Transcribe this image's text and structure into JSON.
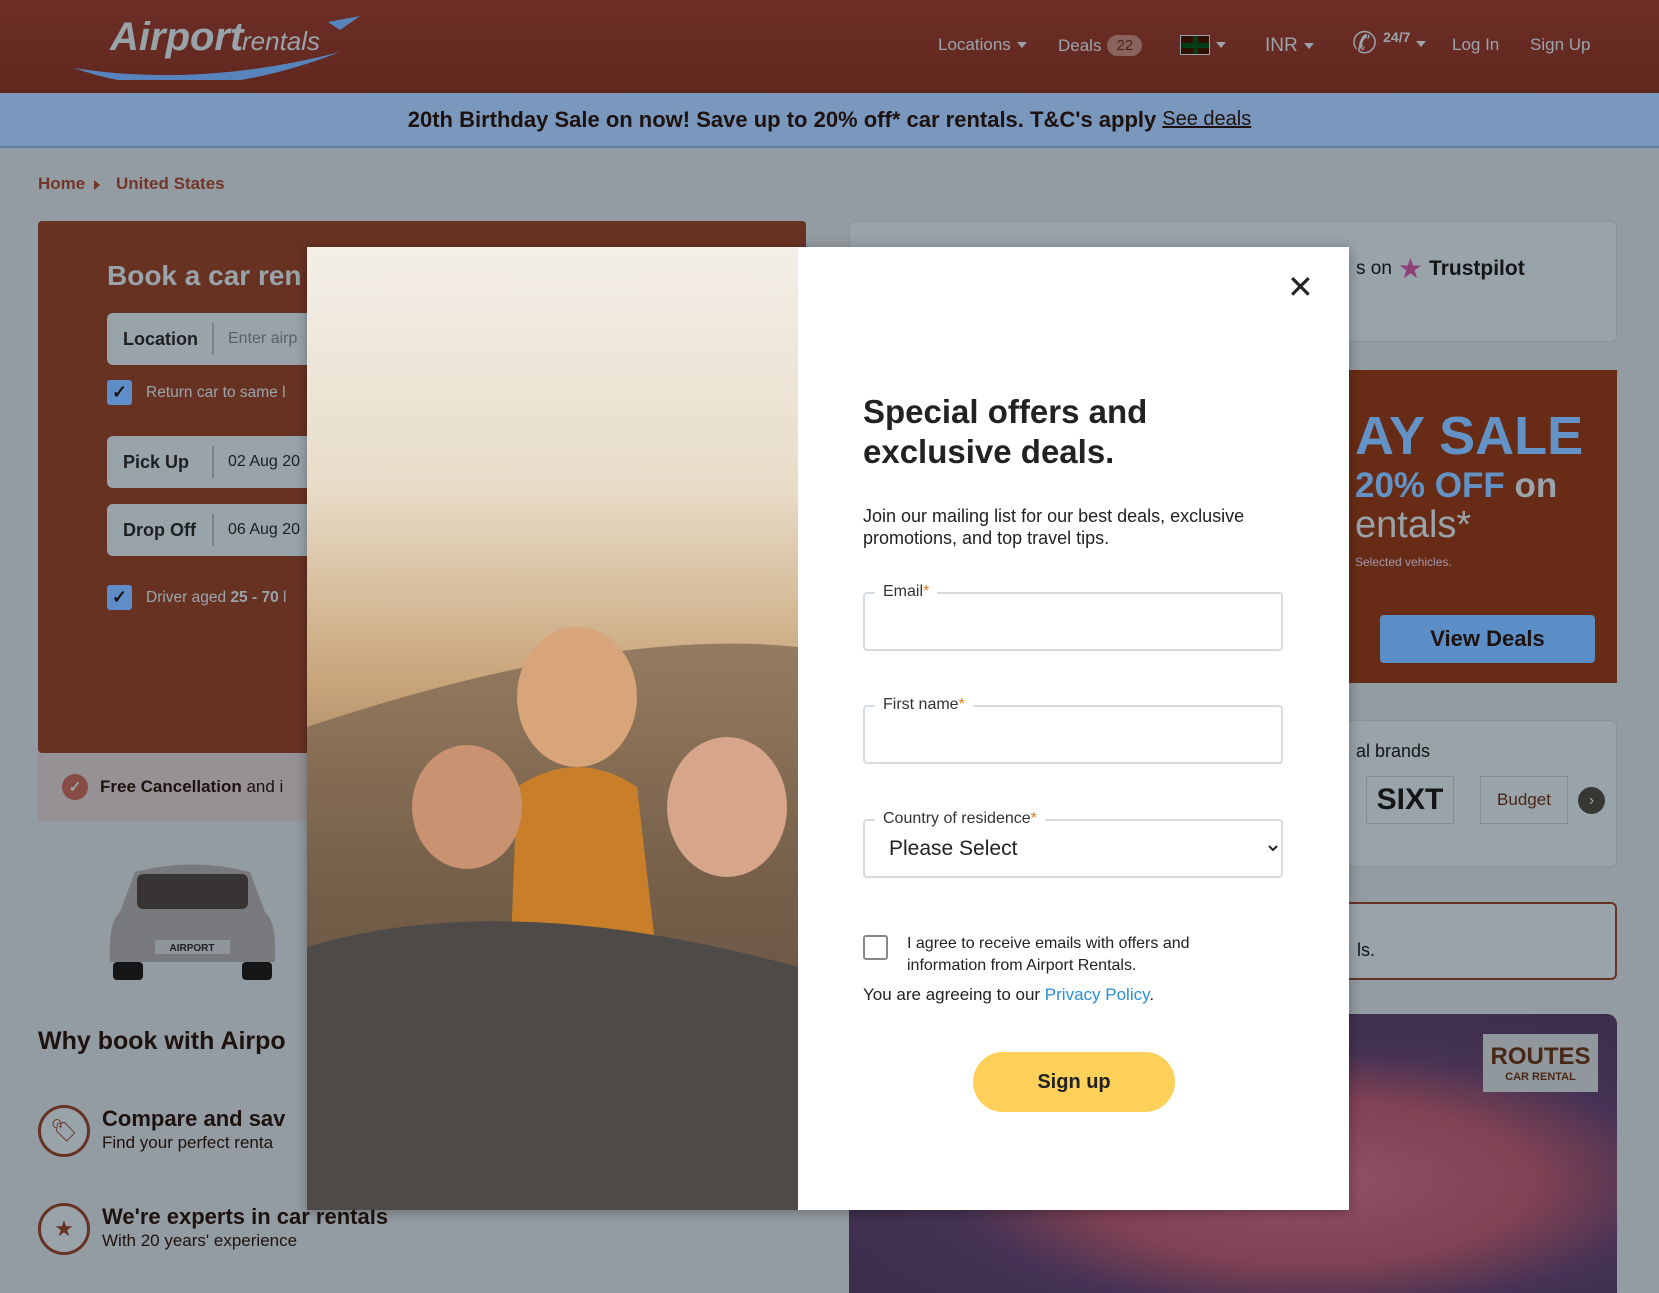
{
  "header": {
    "logo": "Airport rentals",
    "nav": {
      "locations": "Locations",
      "deals": "Deals",
      "deals_count": "22",
      "language_icon": "uk-flag-icon",
      "currency": "INR",
      "phone": "24/7",
      "login": "Log In",
      "signup": "Sign Up"
    }
  },
  "banner": {
    "text": "20th Birthday Sale on now! Save up to 20% off* car rentals. T&C's apply",
    "link": "See deals"
  },
  "breadcrumb": [
    "Home",
    "United States"
  ],
  "booking": {
    "title": "Book a car ren",
    "location_label": "Location",
    "location_placeholder": "Enter airp",
    "return_same": "Return car to same l",
    "pickup_label": "Pick Up",
    "pickup_value": "02 Aug 20",
    "dropoff_label": "Drop Off",
    "dropoff_value": "06 Aug 20",
    "driver_prefix": "Driver aged ",
    "driver_age": "25 - 70",
    "driver_suffix": " l",
    "free_cancel": "Free Cancellation",
    "free_cancel_more": " and i"
  },
  "why": {
    "title": "Why book with Airpo",
    "features": [
      {
        "title": "Compare and sav",
        "sub": "Find your perfect renta"
      },
      {
        "title": "We're experts in car rentals",
        "sub": "With 20 years' experience"
      }
    ]
  },
  "right": {
    "trustpilot_prefix": "s on",
    "trustpilot": "Trustpilot",
    "sale_line1": "AY SALE",
    "sale_line2a": "20% OFF",
    "sale_line2b": " on",
    "sale_line3": "entals*",
    "sale_note": "Selected vehicles.",
    "view_deals": "View Deals",
    "brands_title": "al brands",
    "brands": [
      "SIXT",
      "Budget"
    ],
    "info_text": "ls.",
    "routes_logo": "ROUTES CAR RENTAL"
  },
  "modal": {
    "heading": "Special offers and exclusive deals.",
    "intro": "Join our mailing list for our best deals, exclusive promotions, and top travel tips.",
    "email_label": "Email",
    "first_name_label": "First name",
    "country_label": "Country of residence",
    "country_value": "Please Select",
    "required_mark": "*",
    "consent": "I agree to receive emails with offers and information from Airport Rentals.",
    "privacy_prefix": "You are agreeing to our ",
    "privacy_link": "Privacy Policy",
    "privacy_suffix": ".",
    "submit": "Sign up"
  },
  "colors": {
    "brand_blue": "#1a6cb6",
    "accent_yellow": "#fdd05a",
    "link_blue": "#2a8fd8"
  }
}
